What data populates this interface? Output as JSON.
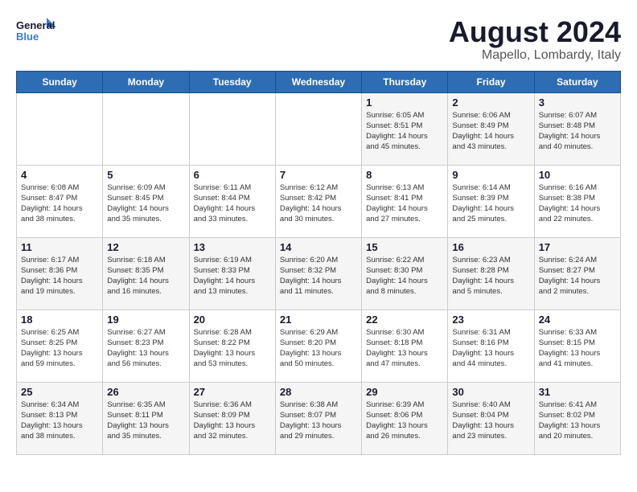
{
  "logo": {
    "text_general": "General",
    "text_blue": "Blue"
  },
  "title": "August 2024",
  "subtitle": "Mapello, Lombardy, Italy",
  "weekdays": [
    "Sunday",
    "Monday",
    "Tuesday",
    "Wednesday",
    "Thursday",
    "Friday",
    "Saturday"
  ],
  "weeks": [
    [
      {
        "day": "",
        "info": ""
      },
      {
        "day": "",
        "info": ""
      },
      {
        "day": "",
        "info": ""
      },
      {
        "day": "",
        "info": ""
      },
      {
        "day": "1",
        "info": "Sunrise: 6:05 AM\nSunset: 8:51 PM\nDaylight: 14 hours\nand 45 minutes."
      },
      {
        "day": "2",
        "info": "Sunrise: 6:06 AM\nSunset: 8:49 PM\nDaylight: 14 hours\nand 43 minutes."
      },
      {
        "day": "3",
        "info": "Sunrise: 6:07 AM\nSunset: 8:48 PM\nDaylight: 14 hours\nand 40 minutes."
      }
    ],
    [
      {
        "day": "4",
        "info": "Sunrise: 6:08 AM\nSunset: 8:47 PM\nDaylight: 14 hours\nand 38 minutes."
      },
      {
        "day": "5",
        "info": "Sunrise: 6:09 AM\nSunset: 8:45 PM\nDaylight: 14 hours\nand 35 minutes."
      },
      {
        "day": "6",
        "info": "Sunrise: 6:11 AM\nSunset: 8:44 PM\nDaylight: 14 hours\nand 33 minutes."
      },
      {
        "day": "7",
        "info": "Sunrise: 6:12 AM\nSunset: 8:42 PM\nDaylight: 14 hours\nand 30 minutes."
      },
      {
        "day": "8",
        "info": "Sunrise: 6:13 AM\nSunset: 8:41 PM\nDaylight: 14 hours\nand 27 minutes."
      },
      {
        "day": "9",
        "info": "Sunrise: 6:14 AM\nSunset: 8:39 PM\nDaylight: 14 hours\nand 25 minutes."
      },
      {
        "day": "10",
        "info": "Sunrise: 6:16 AM\nSunset: 8:38 PM\nDaylight: 14 hours\nand 22 minutes."
      }
    ],
    [
      {
        "day": "11",
        "info": "Sunrise: 6:17 AM\nSunset: 8:36 PM\nDaylight: 14 hours\nand 19 minutes."
      },
      {
        "day": "12",
        "info": "Sunrise: 6:18 AM\nSunset: 8:35 PM\nDaylight: 14 hours\nand 16 minutes."
      },
      {
        "day": "13",
        "info": "Sunrise: 6:19 AM\nSunset: 8:33 PM\nDaylight: 14 hours\nand 13 minutes."
      },
      {
        "day": "14",
        "info": "Sunrise: 6:20 AM\nSunset: 8:32 PM\nDaylight: 14 hours\nand 11 minutes."
      },
      {
        "day": "15",
        "info": "Sunrise: 6:22 AM\nSunset: 8:30 PM\nDaylight: 14 hours\nand 8 minutes."
      },
      {
        "day": "16",
        "info": "Sunrise: 6:23 AM\nSunset: 8:28 PM\nDaylight: 14 hours\nand 5 minutes."
      },
      {
        "day": "17",
        "info": "Sunrise: 6:24 AM\nSunset: 8:27 PM\nDaylight: 14 hours\nand 2 minutes."
      }
    ],
    [
      {
        "day": "18",
        "info": "Sunrise: 6:25 AM\nSunset: 8:25 PM\nDaylight: 13 hours\nand 59 minutes."
      },
      {
        "day": "19",
        "info": "Sunrise: 6:27 AM\nSunset: 8:23 PM\nDaylight: 13 hours\nand 56 minutes."
      },
      {
        "day": "20",
        "info": "Sunrise: 6:28 AM\nSunset: 8:22 PM\nDaylight: 13 hours\nand 53 minutes."
      },
      {
        "day": "21",
        "info": "Sunrise: 6:29 AM\nSunset: 8:20 PM\nDaylight: 13 hours\nand 50 minutes."
      },
      {
        "day": "22",
        "info": "Sunrise: 6:30 AM\nSunset: 8:18 PM\nDaylight: 13 hours\nand 47 minutes."
      },
      {
        "day": "23",
        "info": "Sunrise: 6:31 AM\nSunset: 8:16 PM\nDaylight: 13 hours\nand 44 minutes."
      },
      {
        "day": "24",
        "info": "Sunrise: 6:33 AM\nSunset: 8:15 PM\nDaylight: 13 hours\nand 41 minutes."
      }
    ],
    [
      {
        "day": "25",
        "info": "Sunrise: 6:34 AM\nSunset: 8:13 PM\nDaylight: 13 hours\nand 38 minutes."
      },
      {
        "day": "26",
        "info": "Sunrise: 6:35 AM\nSunset: 8:11 PM\nDaylight: 13 hours\nand 35 minutes."
      },
      {
        "day": "27",
        "info": "Sunrise: 6:36 AM\nSunset: 8:09 PM\nDaylight: 13 hours\nand 32 minutes."
      },
      {
        "day": "28",
        "info": "Sunrise: 6:38 AM\nSunset: 8:07 PM\nDaylight: 13 hours\nand 29 minutes."
      },
      {
        "day": "29",
        "info": "Sunrise: 6:39 AM\nSunset: 8:06 PM\nDaylight: 13 hours\nand 26 minutes."
      },
      {
        "day": "30",
        "info": "Sunrise: 6:40 AM\nSunset: 8:04 PM\nDaylight: 13 hours\nand 23 minutes."
      },
      {
        "day": "31",
        "info": "Sunrise: 6:41 AM\nSunset: 8:02 PM\nDaylight: 13 hours\nand 20 minutes."
      }
    ]
  ]
}
